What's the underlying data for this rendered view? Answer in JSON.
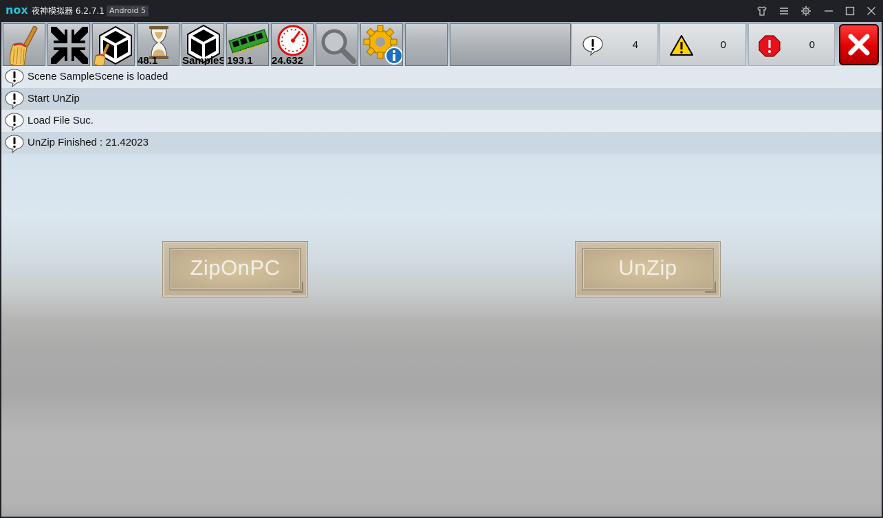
{
  "window": {
    "logo_text": "nox",
    "title": "夜神模拟器 6.2.7.1",
    "badge": "Android 5",
    "controls": [
      {
        "icon": "shirt-icon"
      },
      {
        "icon": "menu-icon"
      },
      {
        "icon": "gear-icon"
      },
      {
        "icon": "minimize-icon"
      },
      {
        "icon": "maximize-icon"
      },
      {
        "icon": "close-icon"
      }
    ]
  },
  "toolbar": {
    "tools": [
      {
        "icon": "broom-icon",
        "value": ""
      },
      {
        "icon": "collapse-arrows-icon",
        "value": ""
      },
      {
        "icon": "unity-broom-icon",
        "value": ""
      },
      {
        "icon": "hourglass-icon",
        "value": "48.1"
      },
      {
        "icon": "unity-logo-icon",
        "value": "SampleS"
      },
      {
        "icon": "memory-chip-icon",
        "value": "193.1"
      },
      {
        "icon": "speedometer-icon",
        "value": "24.632"
      },
      {
        "icon": "magnifier-icon",
        "value": ""
      },
      {
        "icon": "gear-info-icon",
        "value": ""
      },
      {
        "icon": "empty-slot",
        "value": ""
      }
    ],
    "counts": {
      "info": "4",
      "warning": "0",
      "error": "0"
    },
    "colors": {
      "error": "#e8101c",
      "warning": "#ffd200",
      "close": "#e00000"
    }
  },
  "log": [
    {
      "icon": "info-bubble-icon",
      "text": "Scene SampleScene is loaded"
    },
    {
      "icon": "info-bubble-icon",
      "text": "Start UnZip"
    },
    {
      "icon": "info-bubble-icon",
      "text": "Load File Suc."
    },
    {
      "icon": "info-bubble-icon",
      "text": "UnZip Finished : 21.42023"
    }
  ],
  "buttons": {
    "zip": "ZipOnPC",
    "unzip": "UnZip"
  }
}
